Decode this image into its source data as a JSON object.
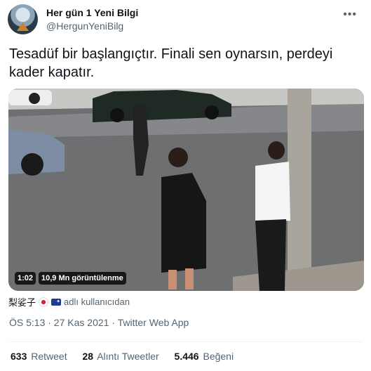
{
  "author": {
    "name": "Her gün 1 Yeni Bilgi",
    "handle": "@HergunYeniBilg"
  },
  "more_label": "•••",
  "tweet_text": "Tesadüf bir başlangıçtır. Finali sen oynarsın, perdeyi kader kapatır.",
  "video": {
    "duration": "1:02",
    "views": "10,9 Mn görüntülenme"
  },
  "tagged": {
    "user": "梨娑子",
    "suffix": "adlı kullanıcıdan"
  },
  "meta": "ÖS 5:13 · 27 Kas 2021 · Twitter Web App",
  "stats": [
    {
      "count": "633",
      "label": "Retweet"
    },
    {
      "count": "28",
      "label": "Alıntı Tweetler"
    },
    {
      "count": "5.446",
      "label": "Beğeni"
    }
  ]
}
